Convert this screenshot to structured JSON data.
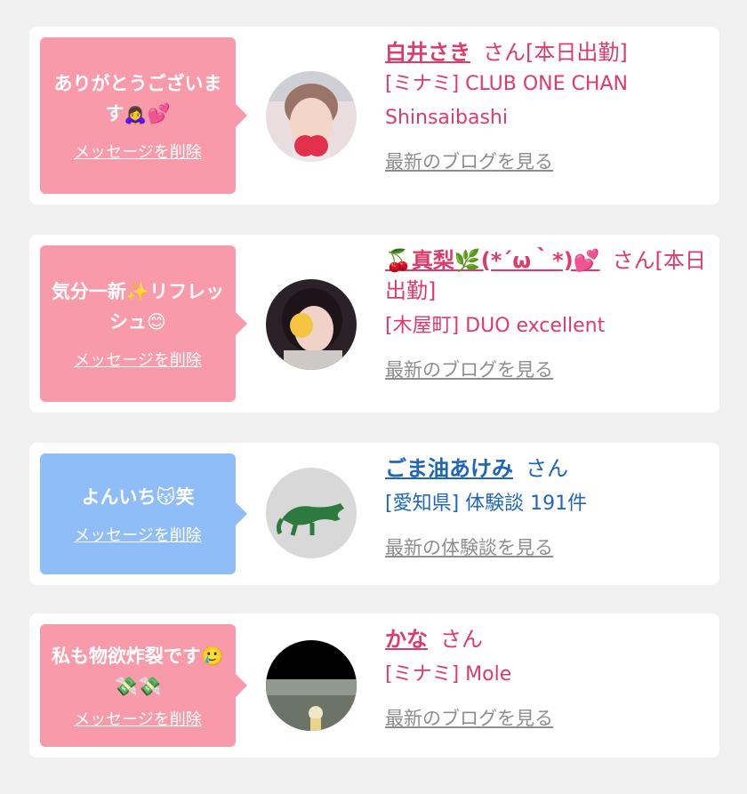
{
  "colors": {
    "pink_bubble": "#f89aaa",
    "blue_bubble": "#8fbdf7",
    "pink_text": "#dd3b6a",
    "blue_text": "#1f66b8",
    "link_gray": "#8d8d8d",
    "background": "#f0f0f0"
  },
  "cards": [
    {
      "message": "ありがとうございます🙇‍♀️💕",
      "delete_label": "メッセージを削除",
      "name": "白井さき",
      "honorific": "さん[本日出勤]",
      "shop": "[ミナミ] CLUB ONE CHAN Shinsaibashi",
      "link": "最新のブログを見る"
    },
    {
      "message": "気分一新✨リフレッシュ😊",
      "delete_label": "メッセージを削除",
      "name": "🍒真梨🌿(*´ω｀*)💕",
      "honorific": "さん[本日出勤]",
      "shop": "[木屋町] DUO excellent",
      "link": "最新のブログを見る"
    },
    {
      "message": "よんいち😽笑",
      "delete_label": "メッセージを削除",
      "name": "ごま油あけみ",
      "honorific": "さん",
      "shop": "[愛知県] 体験談 191件",
      "link": "最新の体験談を見る"
    },
    {
      "message": "私も物欲炸裂です🥲💸💸",
      "delete_label": "メッセージを削除",
      "name": "かな",
      "honorific": "さん",
      "shop": "[ミナミ] Mole",
      "link": "最新のブログを見る"
    }
  ]
}
